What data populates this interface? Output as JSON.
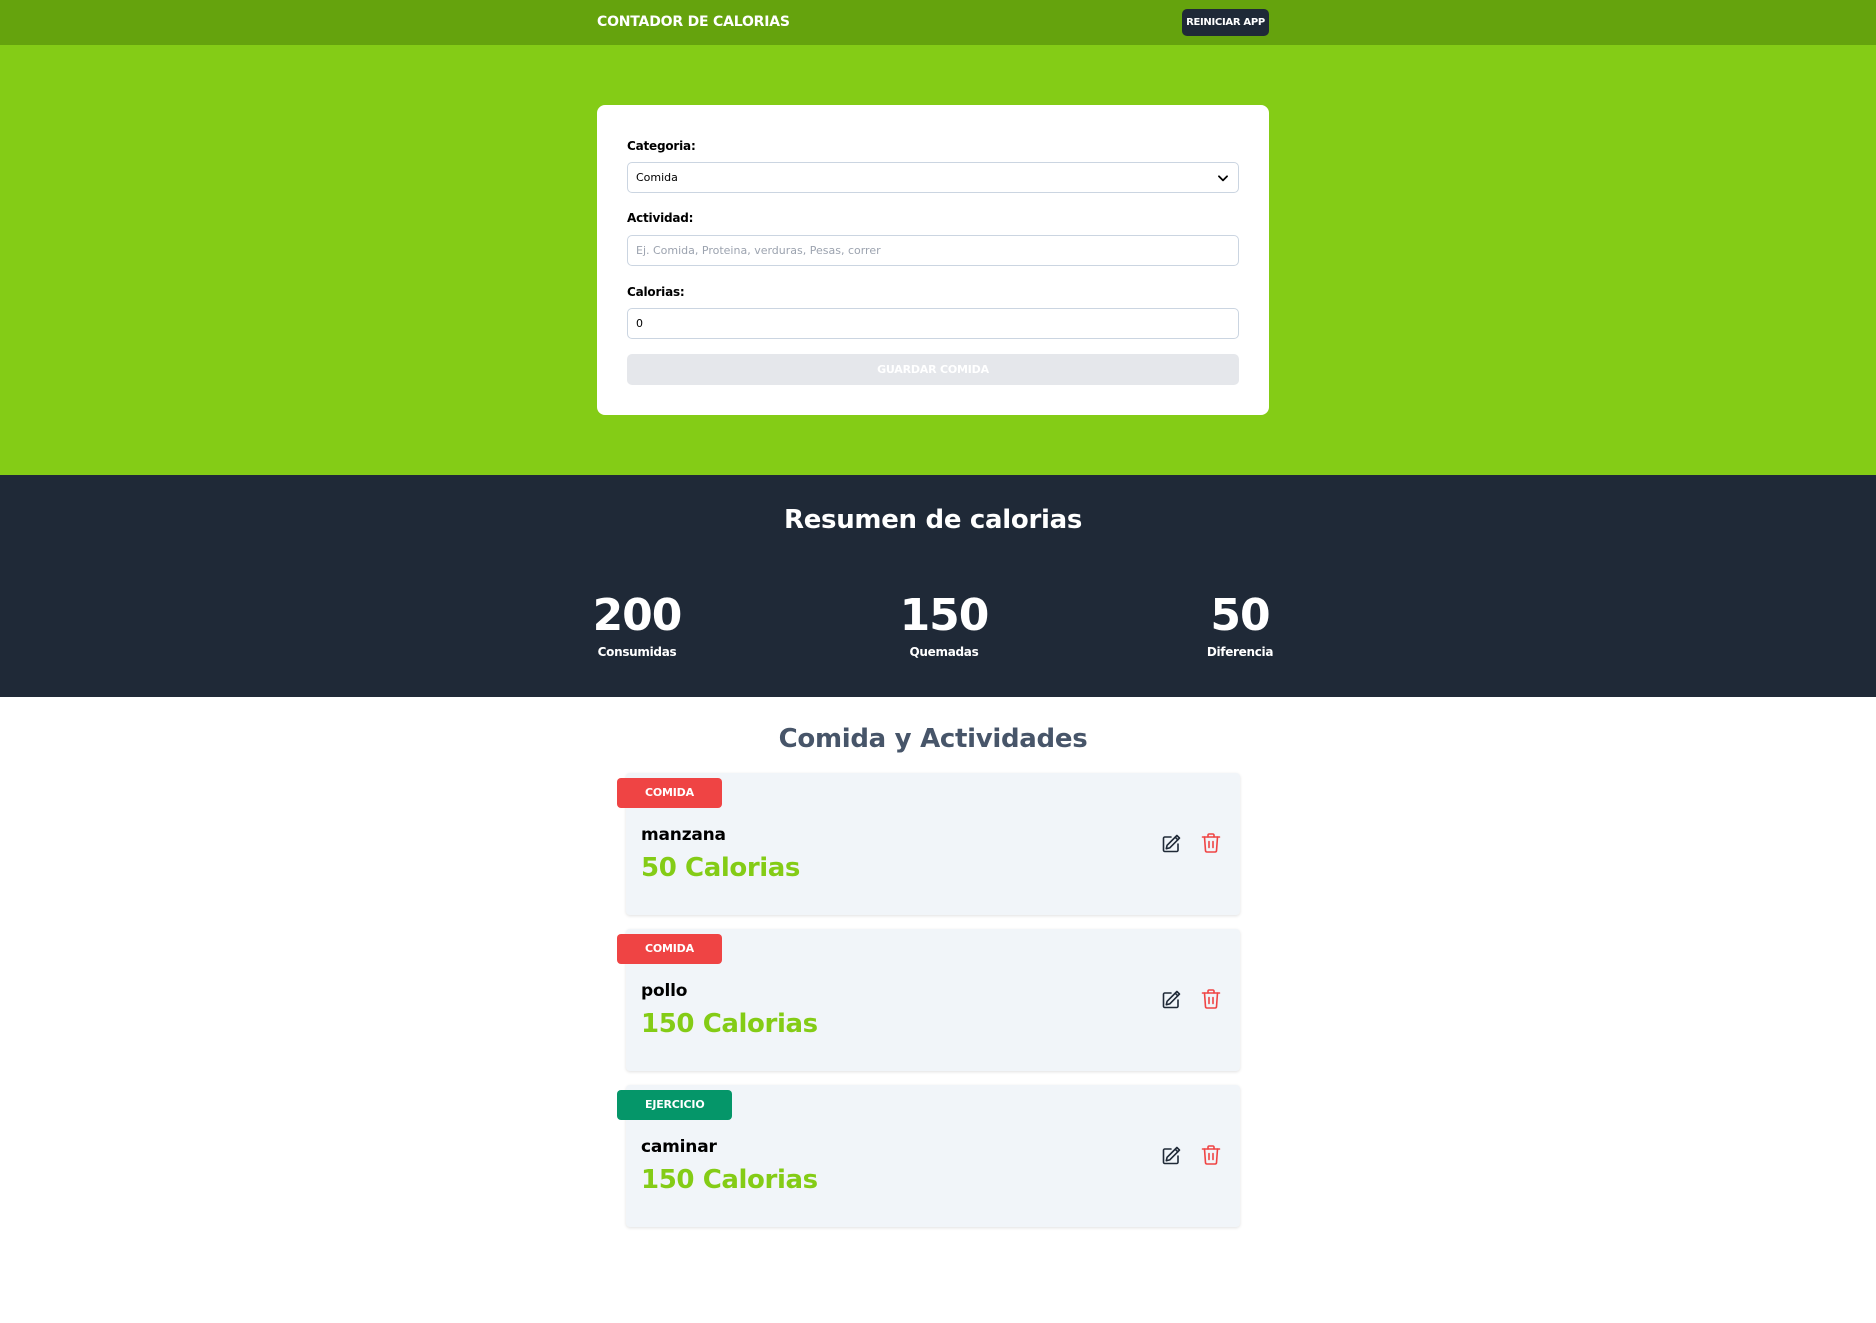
{
  "header": {
    "title": "CONTADOR DE CALORIAS",
    "reset_label": "REINICIAR APP"
  },
  "form": {
    "category_label": "Categoria:",
    "category_value": "Comida",
    "activity_label": "Actividad:",
    "activity_placeholder": "Ej. Comida, Proteina, verduras, Pesas, correr",
    "calories_label": "Calorias:",
    "calories_value": "0",
    "submit_label": "GUARDAR COMIDA"
  },
  "summary": {
    "title": "Resumen de calorias",
    "stats": [
      {
        "value": "200",
        "label": "Consumidas"
      },
      {
        "value": "150",
        "label": "Quemadas"
      },
      {
        "value": "50",
        "label": "Diferencia"
      }
    ]
  },
  "list": {
    "title": "Comida y Actividades",
    "items": [
      {
        "category": "COMIDA",
        "name": "manzana",
        "calories": "50 Calorias"
      },
      {
        "category": "COMIDA",
        "name": "pollo",
        "calories": "150 Calorias"
      },
      {
        "category": "EJERCICIO",
        "name": "caminar",
        "calories": "150 Calorias"
      }
    ]
  },
  "icons": {
    "chevron": "chevron-down-icon",
    "edit": "pencil-square-icon",
    "delete": "trash-icon"
  },
  "colors": {
    "header_bg": "#65a30d",
    "form_bg": "#84cc16",
    "summary_bg": "#1f2937",
    "calories_text": "#84cc16",
    "food_badge": "#ef4444",
    "exercise_badge": "#059669",
    "delete_icon": "#ef4444"
  }
}
